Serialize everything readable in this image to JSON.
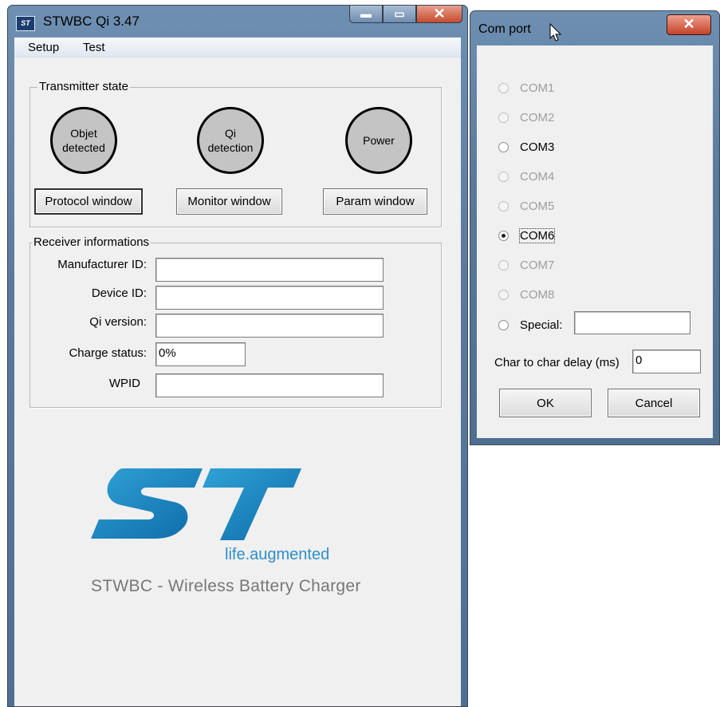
{
  "main_window": {
    "title": "STWBC Qi 3.47",
    "icon": "st-app-icon",
    "caption_buttons": {
      "minimize": "▬",
      "maximize": "▭",
      "close": "✕"
    },
    "menu": [
      "Setup",
      "Test"
    ]
  },
  "transmitter": {
    "group_label": "Transmitter state",
    "indicators": [
      {
        "line1": "Objet",
        "line2": "detected"
      },
      {
        "line1": "Qi",
        "line2": "detection"
      },
      {
        "line1": "Power",
        "line2": ""
      }
    ],
    "buttons": [
      "Protocol window",
      "Monitor window",
      "Param window"
    ]
  },
  "receiver": {
    "group_label": "Receiver informations",
    "fields": [
      {
        "label": "Manufacturer ID:",
        "value": ""
      },
      {
        "label": "Device ID:",
        "value": ""
      },
      {
        "label": "Qi version:",
        "value": ""
      },
      {
        "label": "Charge status:",
        "value": "0%"
      },
      {
        "label": "WPID",
        "value": ""
      }
    ]
  },
  "branding": {
    "tagline_prefix": "life.",
    "tagline_suffix": "augmented",
    "product": "STWBC - Wireless Battery Charger",
    "logo_colors": [
      "#0e6aa8",
      "#2fa3d6"
    ]
  },
  "com_dialog": {
    "title": "Com port",
    "close_glyph": "✕",
    "ports": [
      {
        "label": "COM1",
        "enabled": false,
        "selected": false
      },
      {
        "label": "COM2",
        "enabled": false,
        "selected": false
      },
      {
        "label": "COM3",
        "enabled": true,
        "selected": false
      },
      {
        "label": "COM4",
        "enabled": false,
        "selected": false
      },
      {
        "label": "COM5",
        "enabled": false,
        "selected": false
      },
      {
        "label": "COM6",
        "enabled": true,
        "selected": true
      },
      {
        "label": "COM7",
        "enabled": false,
        "selected": false
      },
      {
        "label": "COM8",
        "enabled": false,
        "selected": false
      }
    ],
    "special_label": "Special:",
    "special_value": "",
    "delay_label": "Char to char delay (ms)",
    "delay_value": "0",
    "ok": "OK",
    "cancel": "Cancel"
  }
}
